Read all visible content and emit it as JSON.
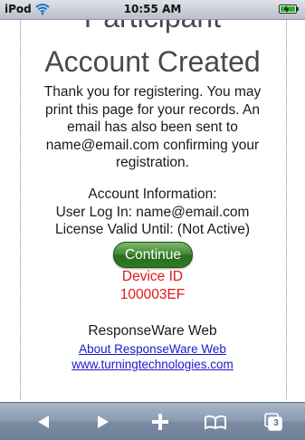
{
  "status_bar": {
    "carrier": "iPod",
    "time": "10:55 AM"
  },
  "page": {
    "heading_cut": "Participant",
    "heading": "Account Created",
    "message_lines": [
      "Thank you for registering. You may",
      "print this page for your records. An",
      "email has also been sent to",
      "name@email.com confirming your",
      "registration."
    ],
    "account_info_label": "Account Information:",
    "user_login": "User Log In: name@email.com",
    "license_valid": "License Valid Until: (Not Active)",
    "continue_label": "Continue",
    "device_id_label": "Device ID",
    "device_id_value": "100003EF",
    "brand": "ResponseWare Web",
    "link_about": "About ResponseWare Web",
    "link_site": "www.turningtechnologies.com"
  },
  "toolbar": {
    "pages_count": "3",
    "icons": [
      "back-arrow-icon",
      "forward-arrow-icon",
      "plus-icon",
      "bookmarks-book-icon",
      "pages-icon"
    ]
  },
  "colors": {
    "heading": "#4a4a4a",
    "device_id": "#e0191b",
    "link": "#1a1aca",
    "button_green": "#3f8a31",
    "toolbar": "#8a9ab0"
  }
}
